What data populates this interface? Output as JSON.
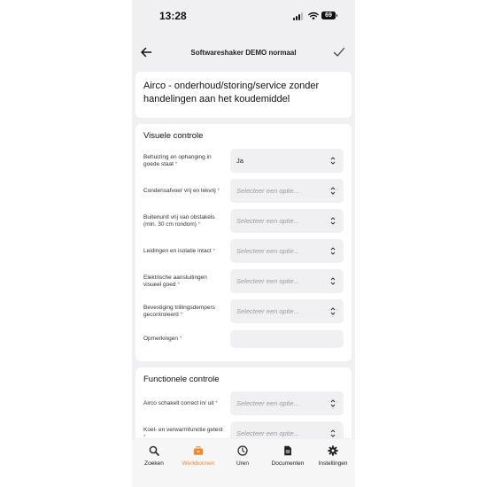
{
  "status_bar": {
    "time": "13:28",
    "battery": "69"
  },
  "nav": {
    "title": "Softwareshaker DEMO normaal"
  },
  "form_title": "Airco - onderhoud/storing/service zonder handelingen aan het koudemiddel",
  "sections": [
    {
      "title": "Visuele controle",
      "fields": [
        {
          "label": "Behuizing en ophanging in goede staat",
          "value": "Ja"
        },
        {
          "label": "Condensafvoer vrij en lekvrij",
          "placeholder": "Selecteer een optie..."
        },
        {
          "label": "Buitenunit vrij van obstakels (min. 30 cm rondom)",
          "placeholder": "Selecteer een optie..."
        },
        {
          "label": "Leidingen en isolatie intact",
          "placeholder": "Selecteer een optie..."
        },
        {
          "label": "Elektrische aansluitingen visueel goed",
          "placeholder": "Selecteer een optie..."
        },
        {
          "label": "Bevestiging trillingsdempers gecontroleerd",
          "placeholder": "Selecteer een optie..."
        },
        {
          "label": "Opmerkingen"
        }
      ]
    },
    {
      "title": "Functionele controle",
      "fields": [
        {
          "label": "Airco schakelt correct in/ uit",
          "placeholder": "Selecteer een optie..."
        },
        {
          "label": "Koel- en verwarmfunctie getest",
          "placeholder": "Selecteer een optie..."
        }
      ]
    }
  ],
  "required_marker": "*",
  "tabs": [
    {
      "label": "Zoeken",
      "icon": "search-icon"
    },
    {
      "label": "Werkbonnen",
      "icon": "briefcase-icon",
      "active": true
    },
    {
      "label": "Uren",
      "icon": "clock-icon"
    },
    {
      "label": "Documenten",
      "icon": "document-icon"
    },
    {
      "label": "Instellingen",
      "icon": "gear-icon"
    }
  ],
  "colors": {
    "accent": "#f08a33",
    "required": "#e4574a",
    "background": "#f0f0f2"
  }
}
